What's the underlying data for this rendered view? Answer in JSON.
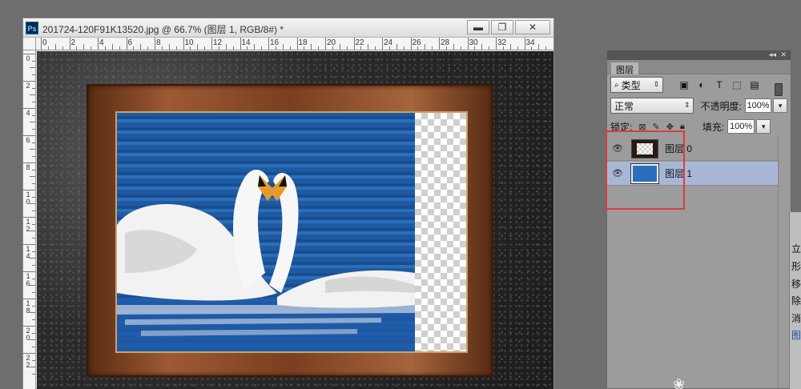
{
  "document": {
    "app_icon_text": "Ps",
    "title": "201724-120F91K13520.jpg @ 66.7% (图层 1, RGB/8#) *",
    "window_buttons": {
      "minimize": "▬",
      "maximize": "❐",
      "close": "✕"
    },
    "hruler_labels": [
      "0",
      "2",
      "4",
      "6",
      "8",
      "10",
      "12",
      "14",
      "16",
      "18",
      "20",
      "22",
      "24",
      "26",
      "28",
      "30",
      "32",
      "34"
    ],
    "vruler_labels": [
      "0",
      "2",
      "4",
      "6",
      "8",
      "1\n0",
      "1\n2",
      "1\n4",
      "1\n6",
      "1\n8",
      "2\n0",
      "2\n2"
    ]
  },
  "layers_panel": {
    "tab_label": "图层",
    "filter_kind": "类型",
    "blend_mode": "正常",
    "opacity_label": "不透明度:",
    "opacity_value": "100%",
    "lock_label": "锁定:",
    "fill_label": "填充:",
    "fill_value": "100%",
    "layers": [
      {
        "name": "图层 0",
        "selected": false
      },
      {
        "name": "图层 1",
        "selected": true
      }
    ]
  },
  "side_panel_items": [
    "立",
    "形",
    "移",
    "除",
    "消",
    "图层"
  ],
  "colors": {
    "highlight": "#e03a3a",
    "selected_layer": "#a9b7d7"
  }
}
